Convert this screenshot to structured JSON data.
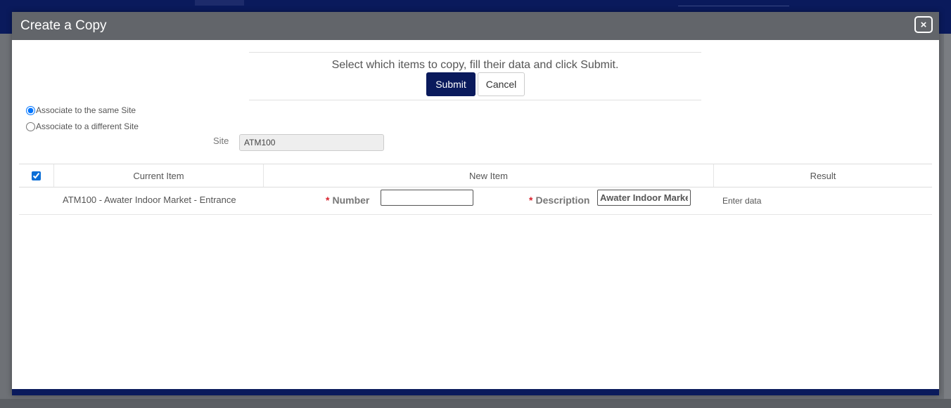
{
  "modal": {
    "title": "Create a Copy",
    "close_label": "×"
  },
  "instructions": {
    "text": "Select which items to copy, fill their data and click Submit.",
    "submit_label": "Submit",
    "cancel_label": "Cancel"
  },
  "association": {
    "same_site_label": "Associate to the same Site",
    "different_site_label": "Associate to a different Site",
    "selected": "same"
  },
  "site": {
    "label": "Site",
    "value": "ATM100"
  },
  "grid": {
    "columns": {
      "current": "Current Item",
      "new": "New Item",
      "result": "Result"
    },
    "select_all_checked": true,
    "rows": [
      {
        "current_item": "ATM100 - Awater Indoor Market - Entrance",
        "number_label": "Number",
        "number_value": "",
        "description_label": "Description",
        "description_value": "Awater Indoor Market - Entrance",
        "result": "Enter data"
      }
    ]
  },
  "colors": {
    "primary": "#0a1a5c",
    "header_bg": "#62656a",
    "required": "#d9232e"
  }
}
